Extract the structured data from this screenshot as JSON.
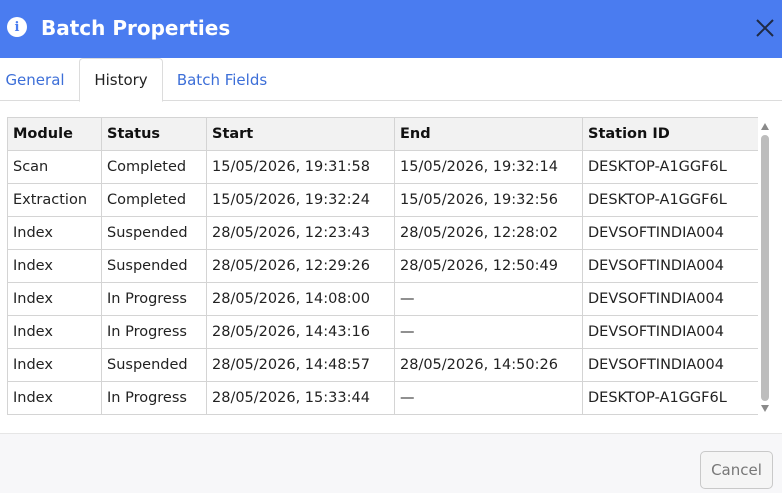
{
  "dialog": {
    "title": "Batch Properties",
    "info_icon": "i",
    "close_icon": "close-icon"
  },
  "tabs": [
    {
      "label": "General",
      "active": false
    },
    {
      "label": "History",
      "active": true
    },
    {
      "label": "Batch Fields",
      "active": false
    }
  ],
  "history": {
    "columns": [
      "Module",
      "Status",
      "Start",
      "End",
      "Station ID"
    ],
    "rows": [
      [
        "Scan",
        "Completed",
        "15/05/2026, 19:31:58",
        "15/05/2026, 19:32:14",
        "DESKTOP-A1GGF6L"
      ],
      [
        "Extraction",
        "Completed",
        "15/05/2026, 19:32:24",
        "15/05/2026, 19:32:56",
        "DESKTOP-A1GGF6L"
      ],
      [
        "Index",
        "Suspended",
        "28/05/2026, 12:23:43",
        "28/05/2026, 12:28:02",
        "DEVSOFTINDIA004"
      ],
      [
        "Index",
        "Suspended",
        "28/05/2026, 12:29:26",
        "28/05/2026, 12:50:49",
        "DEVSOFTINDIA004"
      ],
      [
        "Index",
        "In Progress",
        "28/05/2026, 14:08:00",
        "—",
        "DEVSOFTINDIA004"
      ],
      [
        "Index",
        "In Progress",
        "28/05/2026, 14:43:16",
        "—",
        "DEVSOFTINDIA004"
      ],
      [
        "Index",
        "Suspended",
        "28/05/2026, 14:48:57",
        "28/05/2026, 14:50:26",
        "DEVSOFTINDIA004"
      ],
      [
        "Index",
        "In Progress",
        "28/05/2026, 15:33:44",
        "—",
        "DESKTOP-A1GGF6L"
      ],
      [
        "",
        "",
        "",
        "",
        ""
      ]
    ]
  },
  "footer": {
    "cancel_label": "Cancel"
  },
  "colors": {
    "titlebar": "#4a7cf0",
    "tab_link": "#3d6fd8"
  }
}
